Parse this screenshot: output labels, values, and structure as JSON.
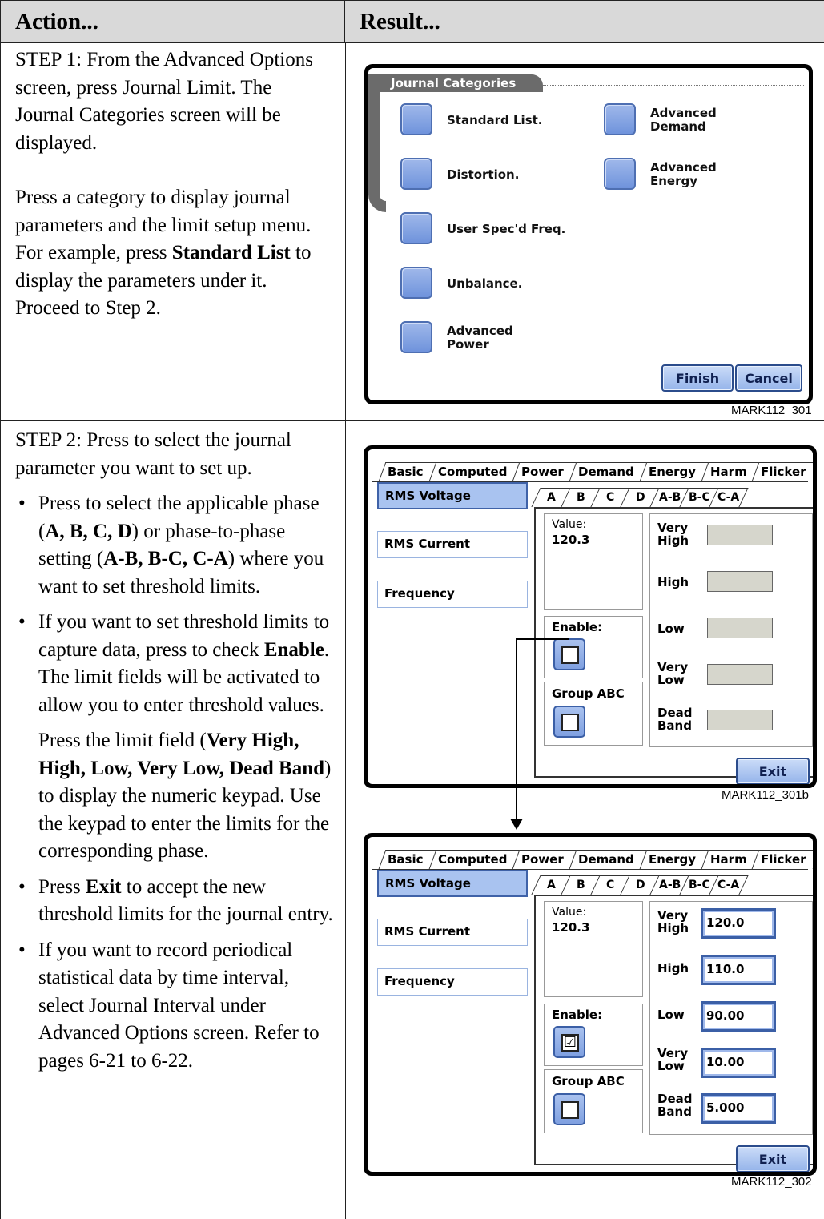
{
  "header": {
    "action": "Action...",
    "result": "Result..."
  },
  "step1": {
    "para1": "STEP 1: From the Advanced Options screen, press Journal Limit. The Journal Categories screen will be displayed.",
    "para2_a": "Press a category to display journal parameters and the limit setup menu. For example, press ",
    "para2_bold": "Standard List",
    "para2_b": " to display the parameters under it. Proceed to Step 2."
  },
  "step2": {
    "intro": "STEP 2: Press to select the journal parameter you want to set up.",
    "b1_a": "Press to select the applicable phase (",
    "b1_bold1": "A, B, C, D",
    "b1_b": ") or phase-to-phase setting (",
    "b1_bold2": "A-B, B-C, C-A",
    "b1_c": ") where you want to set threshold limits.",
    "b2_a": "If you want to set threshold limits to capture data, press to check ",
    "b2_bold": "Enable",
    "b2_b": ". The limit fields will be activated to allow you to enter threshold values.",
    "b2p_a": "Press the limit field (",
    "b2p_bold": "Very High, High, Low, Very Low, Dead Band",
    "b2p_b": ") to display the numeric keypad. Use the keypad to enter the limits for the corresponding phase.",
    "b3_a": "Press ",
    "b3_bold": "Exit",
    "b3_b": " to accept the new threshold limits for the journal entry.",
    "b4": "If you want to record periodical statistical data by time interval, select Journal Interval under Advanced Options screen. Refer to pages 6-21 to 6-22.",
    "bullet": "•"
  },
  "screen1": {
    "title": "Journal Categories",
    "categories": [
      "Standard List.",
      "Distortion.",
      "User Spec'd Freq.",
      "Unbalance.",
      "Advanced Power",
      "Advanced Demand",
      "Advanced Energy"
    ],
    "finish": "Finish",
    "cancel": "Cancel",
    "fig_id": "MARK112_301"
  },
  "screen2": {
    "tabs": [
      "Basic",
      "Computed",
      "Power",
      "Demand",
      "Energy",
      "Harm",
      "Flicker"
    ],
    "params": [
      "RMS Voltage",
      "RMS Current",
      "Frequency"
    ],
    "phases": [
      "A",
      "B",
      "C",
      "D",
      "A-B",
      "B-C",
      "C-A"
    ],
    "value_label": "Value:",
    "value": "120.3",
    "enable_label": "Enable:",
    "group_label": "Group ABC",
    "limits": [
      "Very High",
      "High",
      "Low",
      "Very Low",
      "Dead Band"
    ],
    "exit": "Exit",
    "fig_id": "MARK112_301b"
  },
  "screen3": {
    "tabs": [
      "Basic",
      "Computed",
      "Power",
      "Demand",
      "Energy",
      "Harm",
      "Flicker"
    ],
    "params": [
      "RMS Voltage",
      "RMS Current",
      "Frequency"
    ],
    "phases": [
      "A",
      "B",
      "C",
      "D",
      "A-B",
      "B-C",
      "C-A"
    ],
    "value_label": "Value:",
    "value": "120.3",
    "enable_label": "Enable:",
    "enable_mark": "☑",
    "group_label": "Group ABC",
    "limits": [
      "Very High",
      "High",
      "Low",
      "Very Low",
      "Dead Band"
    ],
    "limit_values": [
      "120.0",
      "110.0",
      "90.00",
      "10.00",
      "5.000"
    ],
    "exit": "Exit",
    "fig_id": "MARK112_302"
  }
}
